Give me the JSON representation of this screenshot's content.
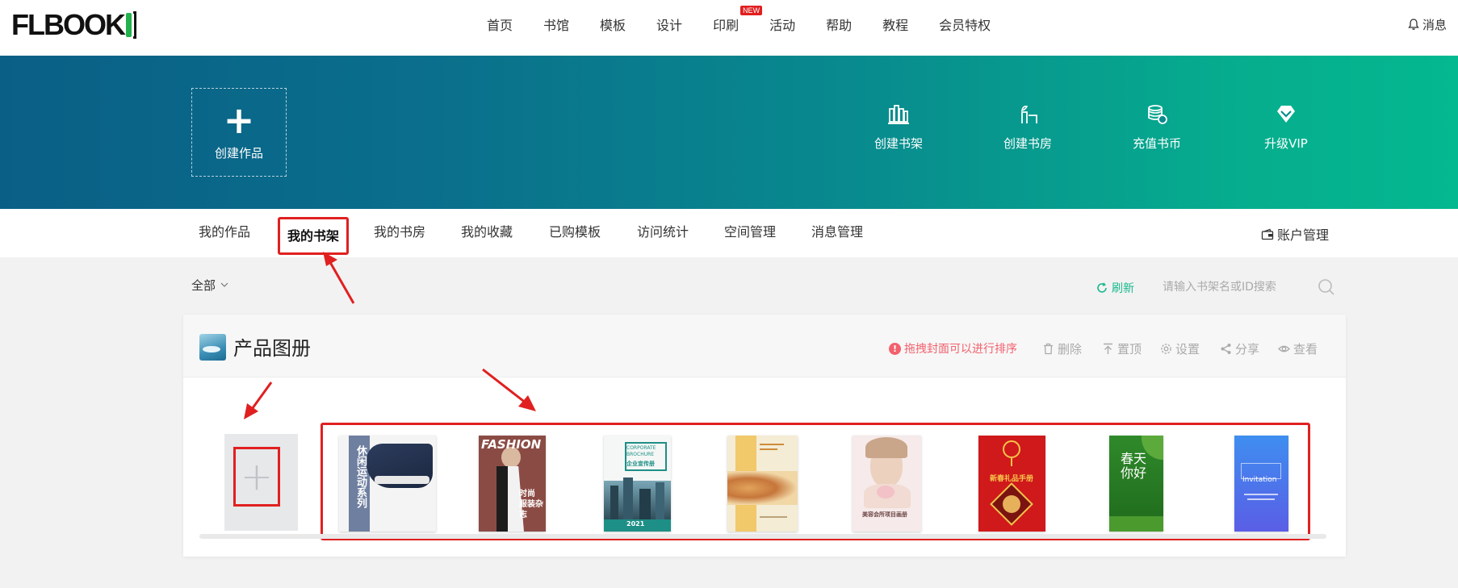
{
  "logo": {
    "text": "FLBOOK"
  },
  "nav": {
    "items": [
      "首页",
      "书馆",
      "模板",
      "设计",
      "印刷",
      "活动",
      "帮助",
      "教程",
      "会员特权"
    ],
    "new_badge": "NEW",
    "messages": "消息"
  },
  "banner": {
    "create": "创建作品",
    "quick_actions": [
      "创建书架",
      "创建书房",
      "充值书币",
      "升级VIP"
    ]
  },
  "tabs": {
    "items": [
      "我的作品",
      "我的书架",
      "我的书房",
      "我的收藏",
      "已购模板",
      "访问统计",
      "空间管理",
      "消息管理"
    ],
    "active": "我的书架",
    "account": "账户管理"
  },
  "toolbar": {
    "filter": "全部",
    "refresh": "刷新",
    "search_placeholder": "请输入书架名或ID搜索"
  },
  "shelf": {
    "title": "产品图册",
    "hint": "拖拽封面可以进行排序",
    "actions": [
      "删除",
      "置顶",
      "设置",
      "分享",
      "查看"
    ]
  },
  "books": [
    {
      "cover_title": "休闲运动系列",
      "bg": "#f4f4f4",
      "accent": "#6f7fa0"
    },
    {
      "cover_title": "FASHION",
      "cover_sub": "时尚 服装杂志",
      "bg": "#8b4b45",
      "accent": "#ffffff"
    },
    {
      "cover_title": "CORPORATE BROCHURE",
      "cover_sub": "企业宣传册",
      "year": "2021",
      "bg": "#1e8f86",
      "accent": "#ffffff"
    },
    {
      "cover_title": "",
      "bg": "#f1c86a",
      "accent": "#d08b3c"
    },
    {
      "cover_title": "美容会所项目画册",
      "bg": "#f6eaea",
      "accent": "#c27d7d"
    },
    {
      "cover_title": "新春礼品手册",
      "bg": "#d0191b",
      "accent": "#f6c34a"
    },
    {
      "cover_title": "春天你好",
      "bg": "#2f8a2a",
      "accent": "#ffffff"
    },
    {
      "cover_title": "Invitation",
      "bg": "#3b74e6",
      "accent": "#ffffff"
    }
  ],
  "colors": {
    "banner_start": "#0a5f86",
    "banner_end": "#04b890",
    "highlight": "#e02020",
    "refresh": "#19b98e",
    "hint": "#f2616d"
  }
}
